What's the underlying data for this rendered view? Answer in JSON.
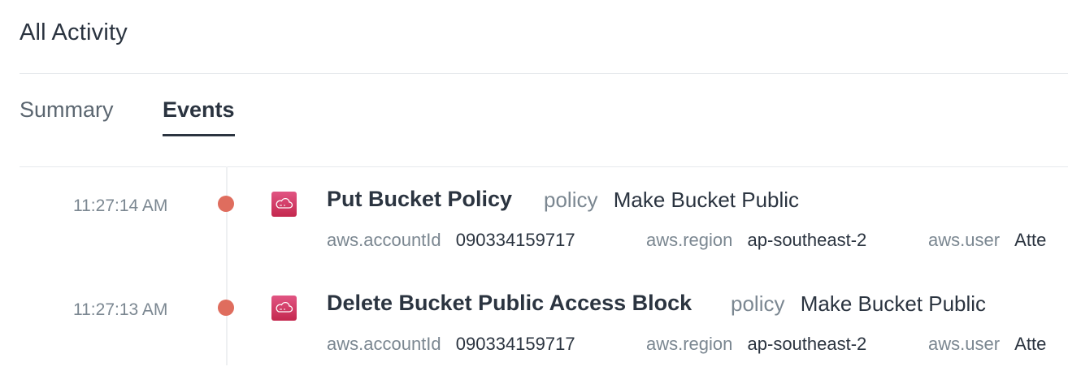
{
  "header": {
    "title": "All Activity"
  },
  "tabs": [
    {
      "label": "Summary"
    },
    {
      "label": "Events"
    }
  ],
  "events": [
    {
      "time": "11:27:14 AM",
      "icon": "aws-cloud-icon",
      "title": "Put Bucket Policy",
      "tag_key": "policy",
      "tag_value": "Make Bucket Public",
      "meta": [
        {
          "key": "aws.accountId",
          "value": "090334159717"
        },
        {
          "key": "aws.region",
          "value": "ap-southeast-2"
        },
        {
          "key": "aws.user",
          "value": "Atte"
        }
      ]
    },
    {
      "time": "11:27:13 AM",
      "icon": "aws-cloud-icon",
      "title": "Delete Bucket Public Access Block",
      "tag_key": "policy",
      "tag_value": "Make Bucket Public",
      "meta": [
        {
          "key": "aws.accountId",
          "value": "090334159717"
        },
        {
          "key": "aws.region",
          "value": "ap-southeast-2"
        },
        {
          "key": "aws.user",
          "value": "Atte"
        }
      ]
    }
  ],
  "colors": {
    "dot": "#df6d5e",
    "icon_bg": "#d43f6a",
    "text_primary": "#2b3440",
    "text_secondary": "#7b8791"
  }
}
